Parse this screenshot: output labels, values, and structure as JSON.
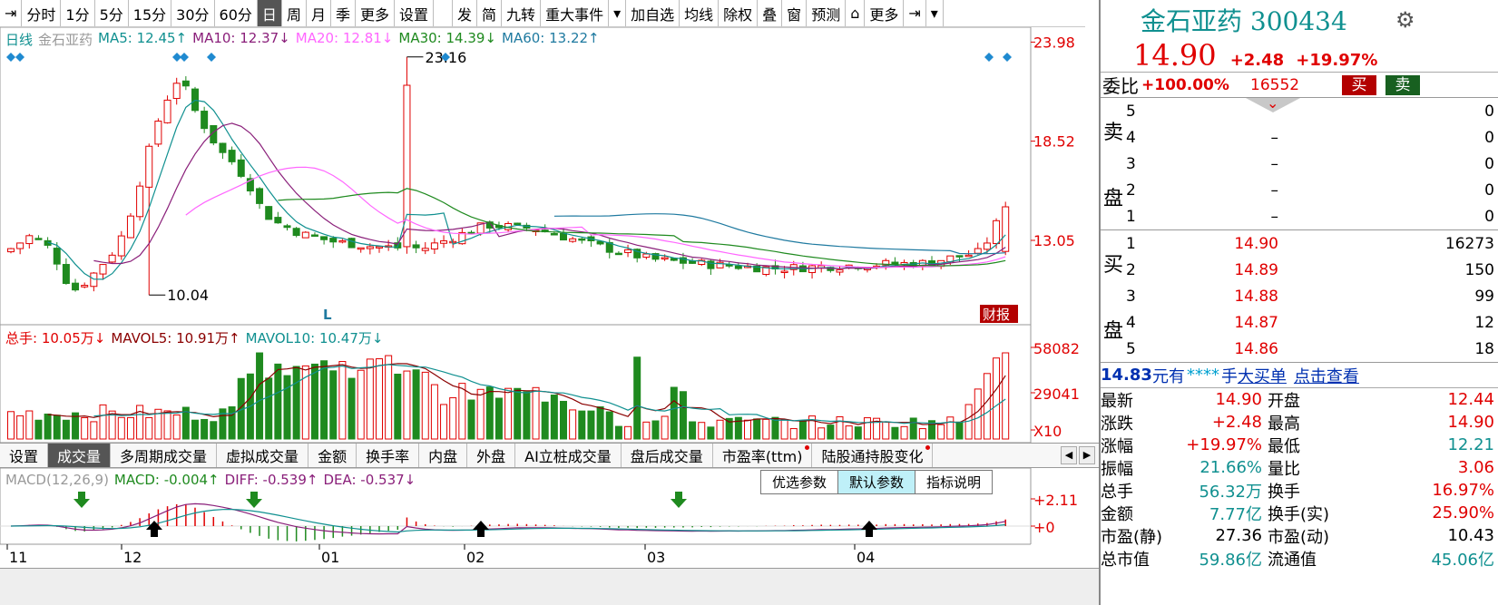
{
  "toolbar": {
    "items": [
      {
        "label": "⇥",
        "name": "first-button"
      },
      {
        "label": "分时",
        "name": "timeshare-button"
      },
      {
        "label": "1分",
        "name": "1min-button"
      },
      {
        "label": "5分",
        "name": "5min-button"
      },
      {
        "label": "15分",
        "name": "15min-button"
      },
      {
        "label": "30分",
        "name": "30min-button"
      },
      {
        "label": "60分",
        "name": "60min-button"
      },
      {
        "label": "日",
        "name": "daily-button",
        "active": true
      },
      {
        "label": "周",
        "name": "weekly-button"
      },
      {
        "label": "月",
        "name": "monthly-button"
      },
      {
        "label": "季",
        "name": "quarterly-button"
      },
      {
        "label": "更多",
        "name": "more-period-button"
      },
      {
        "label": "设置",
        "name": "settings-button"
      },
      {
        "label": "发",
        "name": "fa-button",
        "gap": true
      },
      {
        "label": "简",
        "name": "jian-button",
        "flag": true
      },
      {
        "label": "九转",
        "name": "jiuzhuan-button",
        "flag": true
      },
      {
        "label": "重大事件",
        "name": "major-events-button",
        "flag": true
      },
      {
        "label": "▾",
        "name": "events-dropdown-button"
      },
      {
        "label": "加自选",
        "name": "add-watchlist-button"
      },
      {
        "label": "均线",
        "name": "ma-button"
      },
      {
        "label": "除权",
        "name": "exright-button"
      },
      {
        "label": "叠",
        "name": "overlay-button"
      },
      {
        "label": "窗",
        "name": "window-button"
      },
      {
        "label": "预测",
        "name": "forecast-button"
      },
      {
        "label": "⌂",
        "name": "lock-button"
      },
      {
        "label": "更多",
        "name": "more-tools-button"
      },
      {
        "label": "⇥",
        "name": "last-button"
      },
      {
        "label": "▾",
        "name": "toolbar-dropdown-button"
      }
    ]
  },
  "ma_legend": [
    {
      "text": "日线",
      "color": "#109090"
    },
    {
      "text": "金石亚药",
      "color": "#999999"
    },
    {
      "text": "MA5: 12.45↑",
      "color": "#109090"
    },
    {
      "text": "MA10: 12.37↓",
      "color": "#8a1f7a"
    },
    {
      "text": "MA20: 12.81↓",
      "color": "#ff66ff"
    },
    {
      "text": "MA30: 14.39↓",
      "color": "#1f8a1f"
    },
    {
      "text": "MA60: 13.22↑",
      "color": "#1f7aa0"
    }
  ],
  "vol_legend": [
    {
      "text": "总手: 10.05万↓",
      "color": "#e00000"
    },
    {
      "text": "MAVOL5: 10.91万↑",
      "color": "#8a0000"
    },
    {
      "text": "MAVOL10: 10.47万↓",
      "color": "#109090"
    }
  ],
  "macd_legend": [
    {
      "text": "MACD(12,26,9)",
      "color": "#999999"
    },
    {
      "text": "MACD: -0.004↑",
      "color": "#1f8a1f"
    },
    {
      "text": "DIFF: -0.539↑",
      "color": "#8a1f7a"
    },
    {
      "text": "DEA: -0.537↓",
      "color": "#8a1f7a"
    }
  ],
  "price_axis": {
    "labels": [
      "23.98",
      "18.52",
      "13.05"
    ],
    "values": [
      23.98,
      18.52,
      13.05
    ]
  },
  "vol_axis": {
    "labels": [
      "58082",
      "29041",
      "X10"
    ]
  },
  "macd_axis": {
    "labels": [
      "+2.11",
      "+0"
    ]
  },
  "annotations": {
    "high_label": "23.16",
    "high_value": 23.16,
    "low_label": "10.04",
    "low_value": 10.04,
    "l_marker": "L",
    "caibao_badge": "财报"
  },
  "x_axis": {
    "labels": [
      "11",
      "12",
      "01",
      "02",
      "03",
      "04"
    ]
  },
  "indicator_tabs": [
    {
      "label": "设置",
      "name": "tab-settings"
    },
    {
      "label": "成交量",
      "name": "tab-volume",
      "active": true
    },
    {
      "label": "多周期成交量",
      "name": "tab-multi-period-volume"
    },
    {
      "label": "虚拟成交量",
      "name": "tab-virtual-volume"
    },
    {
      "label": "金额",
      "name": "tab-amount"
    },
    {
      "label": "换手率",
      "name": "tab-turnover"
    },
    {
      "label": "内盘",
      "name": "tab-inner"
    },
    {
      "label": "外盘",
      "name": "tab-outer"
    },
    {
      "label": "AI立桩成交量",
      "name": "tab-ai-volume"
    },
    {
      "label": "盘后成交量",
      "name": "tab-after-hours-volume"
    },
    {
      "label": "市盈率(ttm)",
      "name": "tab-pe-ttm",
      "dot": true
    },
    {
      "label": "陆股通持股变化",
      "name": "tab-connect-holding",
      "dot": true
    }
  ],
  "param_buttons": [
    {
      "label": "优选参数",
      "name": "optimal-params-button"
    },
    {
      "label": "默认参数",
      "name": "default-params-button",
      "active": true
    },
    {
      "label": "指标说明",
      "name": "indicator-help-button"
    }
  ],
  "stock": {
    "name": "金石亚药 300434",
    "price": "14.90",
    "change": "+2.48",
    "change_pct": "+19.97%"
  },
  "weibi": {
    "label": "委比",
    "pct": "+100.00%",
    "amount": "16552",
    "buy": "买",
    "sell": "卖"
  },
  "sell_book": {
    "side": [
      "卖",
      "盘"
    ],
    "rows": [
      {
        "lv": "5",
        "price": "",
        "vol": "0"
      },
      {
        "lv": "4",
        "price": "–",
        "vol": "0"
      },
      {
        "lv": "3",
        "price": "–",
        "vol": "0"
      },
      {
        "lv": "2",
        "price": "–",
        "vol": "0"
      },
      {
        "lv": "1",
        "price": "–",
        "vol": "0"
      }
    ]
  },
  "buy_book": {
    "side": [
      "买",
      "盘"
    ],
    "rows": [
      {
        "lv": "1",
        "price": "14.90",
        "vol": "16273"
      },
      {
        "lv": "2",
        "price": "14.89",
        "vol": "150"
      },
      {
        "lv": "3",
        "price": "14.88",
        "vol": "99"
      },
      {
        "lv": "4",
        "price": "14.87",
        "vol": "12"
      },
      {
        "lv": "5",
        "price": "14.86",
        "vol": "18"
      }
    ]
  },
  "big_order": {
    "price": "14.83",
    "t1": "元有",
    "stars": "****",
    "t2": "手",
    "t3": "大买单",
    "t4": "点击查看"
  },
  "stats": [
    {
      "k": "最新",
      "v": "14.90",
      "vc": "red",
      "k2": "开盘",
      "v2": "12.44",
      "v2c": "red"
    },
    {
      "k": "涨跌",
      "v": "+2.48",
      "vc": "red",
      "k2": "最高",
      "v2": "14.90",
      "v2c": "red"
    },
    {
      "k": "涨幅",
      "v": "+19.97%",
      "vc": "red",
      "k2": "最低",
      "v2": "12.21",
      "v2c": "teal"
    },
    {
      "k": "振幅",
      "v": "21.66%",
      "vc": "teal",
      "k2": "量比",
      "v2": "3.06",
      "v2c": "red"
    },
    {
      "k": "总手",
      "v": "56.32万",
      "vc": "teal",
      "k2": "换手",
      "v2": "16.97%",
      "v2c": "red"
    },
    {
      "k": "金额",
      "v": "7.77亿",
      "vc": "teal",
      "k2": "换手(实)",
      "v2": "25.90%",
      "v2c": "red"
    },
    {
      "k": "市盈(静)",
      "v": "27.36",
      "vc": "blk",
      "k2": "市盈(动)",
      "v2": "10.43",
      "v2c": "blk"
    },
    {
      "k": "总市值",
      "v": "59.86亿",
      "vc": "teal",
      "k2": "流通值",
      "v2": "45.06亿",
      "v2c": "teal"
    }
  ],
  "colors": {
    "up": "#e00000",
    "down": "#1f8a1f",
    "accent": "#109090",
    "grid": "#cccccc"
  }
}
